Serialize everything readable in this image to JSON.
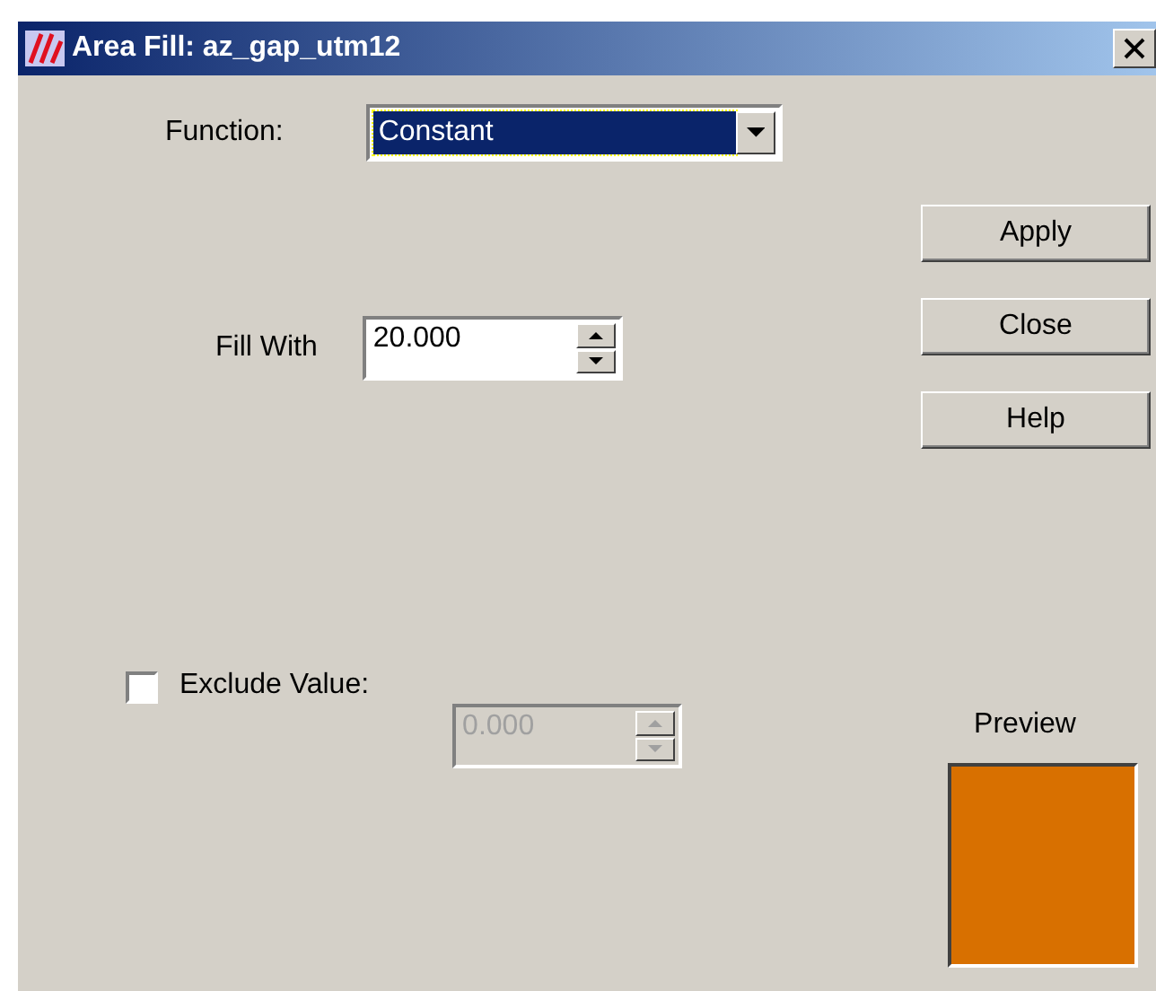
{
  "window": {
    "title": "Area Fill: az_gap_utm12"
  },
  "function": {
    "label": "Function:",
    "value": "Constant",
    "focused": true
  },
  "fill_with": {
    "label": "Fill With",
    "value": "20.000"
  },
  "exclude": {
    "label": "Exclude Value:",
    "checked": false,
    "value": "0.000",
    "disabled": true
  },
  "buttons": [
    "Apply",
    "Close",
    "Help"
  ],
  "preview": {
    "label": "Preview",
    "color": "#d87000"
  }
}
